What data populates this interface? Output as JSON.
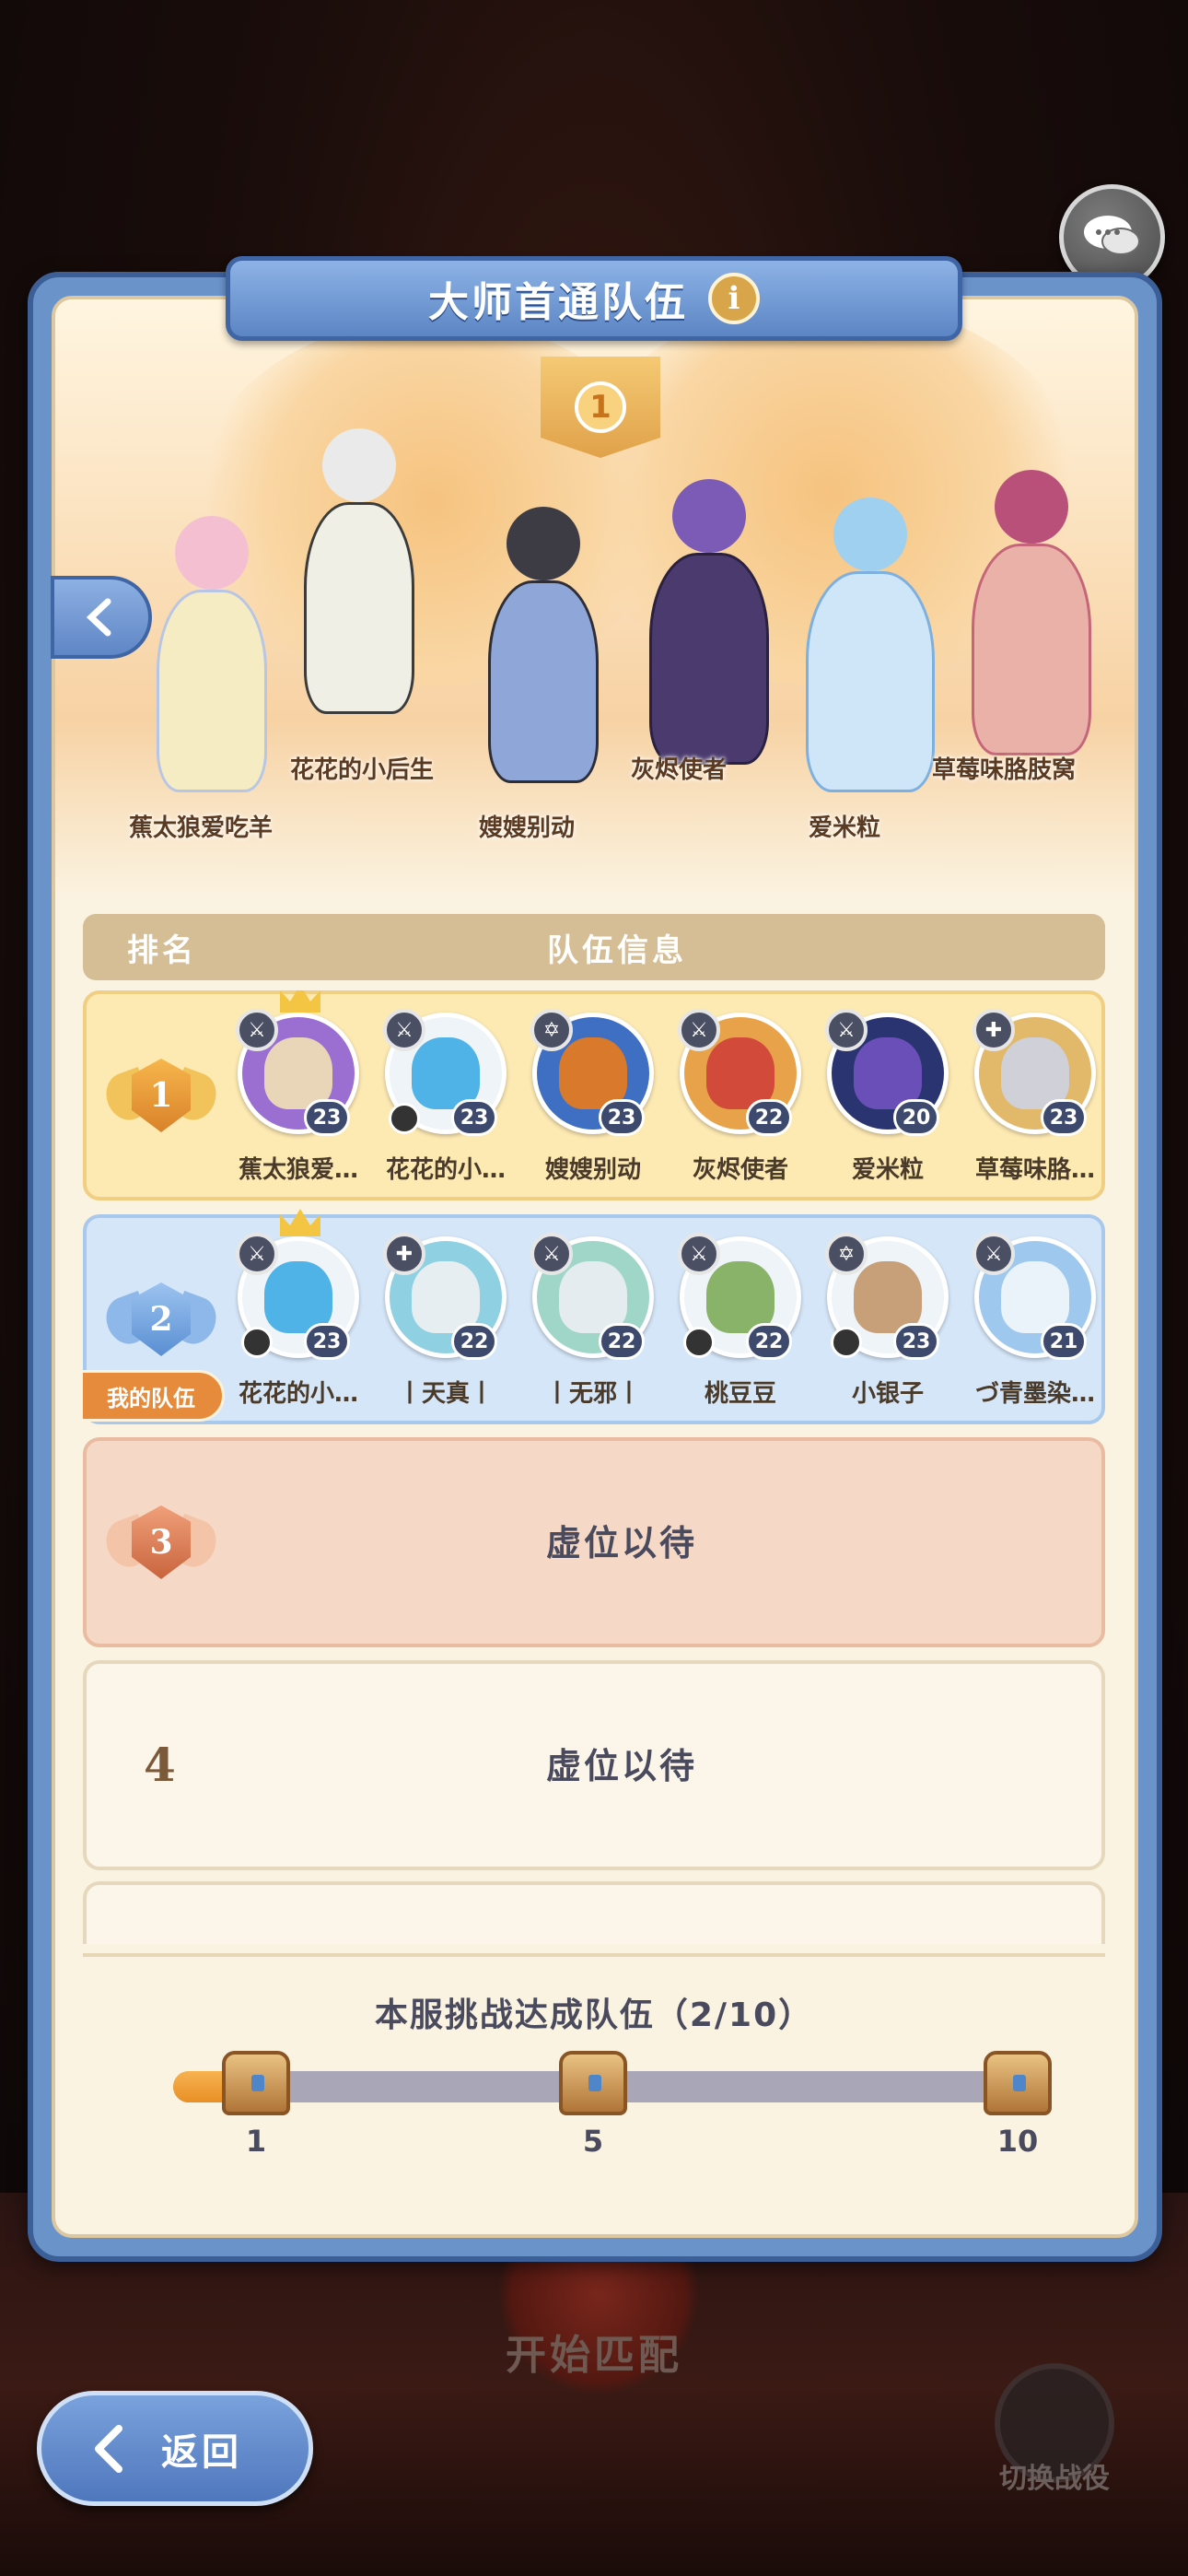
{
  "panel": {
    "title": "大师首通队伍",
    "top_banner_rank": "1",
    "hero_names": [
      "蕉太狼爱吃羊",
      "花花的小后生",
      "嫂嫂别动",
      "灰烬使者",
      "爱米粒",
      "草莓味胳肢窝"
    ]
  },
  "table": {
    "header_rank": "排名",
    "header_info": "队伍信息",
    "rows": [
      {
        "rank": "1",
        "members": [
          {
            "name": "蕉太狼爱…",
            "level": "23",
            "color": "#9b6fd1"
          },
          {
            "name": "花花的小…",
            "level": "23",
            "color": "#4fb3e8"
          },
          {
            "name": "嫂嫂别动",
            "level": "23",
            "color": "#d9792c"
          },
          {
            "name": "灰烬使者",
            "level": "22",
            "color": "#d24a3a"
          },
          {
            "name": "爱米粒",
            "level": "20",
            "color": "#3a4fa8"
          },
          {
            "name": "草莓味胳…",
            "level": "23",
            "color": "#e2b86a"
          }
        ]
      },
      {
        "rank": "2",
        "my_team_label": "我的队伍",
        "members": [
          {
            "name": "花花的小…",
            "level": "23",
            "color": "#4fb3e8"
          },
          {
            "name": "丨天真丨",
            "level": "22",
            "color": "#8fd0e2"
          },
          {
            "name": "丨无邪丨",
            "level": "22",
            "color": "#9fd6c8"
          },
          {
            "name": "桃豆豆",
            "level": "22",
            "color": "#8ab36a"
          },
          {
            "name": "小银子",
            "level": "23",
            "color": "#c7a07a"
          },
          {
            "name": "づ青墨染…",
            "level": "21",
            "color": "#9fc8ee"
          }
        ]
      },
      {
        "rank": "3",
        "text": "虚位以待"
      },
      {
        "rank": "4",
        "text": "虚位以待"
      }
    ]
  },
  "challenge": {
    "title": "本服挑战达成队伍（2/10）",
    "progress": 0.11,
    "milestones": [
      "1",
      "5",
      "10"
    ]
  },
  "background": {
    "start_match": "开始匹配",
    "switch_campaign": "切换战役"
  },
  "back_button": {
    "label": "返回"
  },
  "colors": {
    "panel_blue": "#6a93c9",
    "accent_orange": "#e98f26",
    "cream": "#fbf3e1"
  }
}
